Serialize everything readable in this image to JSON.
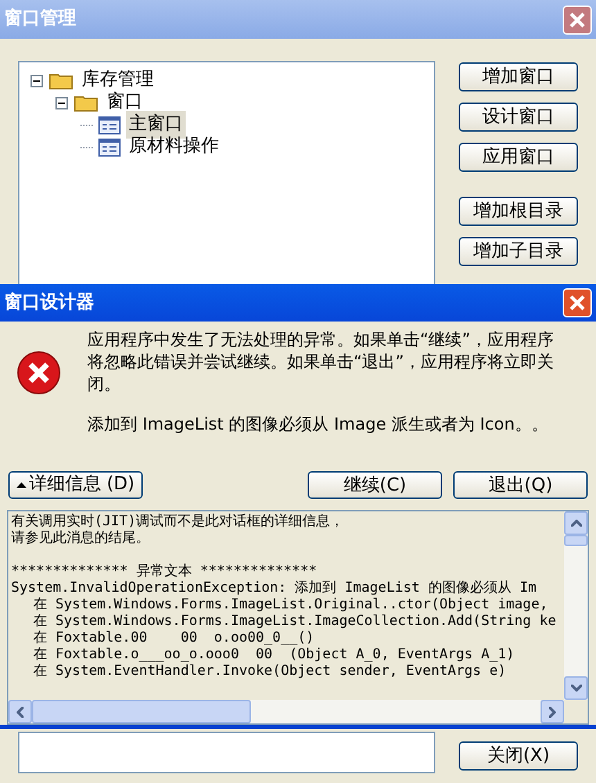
{
  "manager": {
    "title": "窗口管理",
    "tree": [
      {
        "label": "库存管理",
        "kind": "folder",
        "expanded": true,
        "selected": false,
        "children": [
          {
            "label": "窗口",
            "kind": "folder",
            "expanded": true,
            "selected": false,
            "children": [
              {
                "label": "主窗口",
                "kind": "form",
                "selected": true
              },
              {
                "label": "原材料操作",
                "kind": "form",
                "selected": false
              }
            ]
          }
        ]
      }
    ],
    "button_groups": [
      [
        "增加窗口",
        "设计窗口",
        "应用窗口"
      ],
      [
        "增加根目录",
        "增加子目录"
      ]
    ],
    "close_button": "关闭(X)"
  },
  "dialog": {
    "title": "窗口设计器",
    "message": "应用程序中发生了无法处理的异常。如果单击“继续”，应用程序将忽略此错误并尝试继续。如果单击“退出”，应用程序将立即关闭。",
    "detail_message": "添加到 ImageList 的图像必须从 Image 派生或者为 Icon。。",
    "details_button": "详细信息 (D)",
    "buttons": [
      "继续(C)",
      "退出(Q)"
    ],
    "details": [
      {
        "text": "有关调用实时(JIT)调试而不是此对话框的详细信息，",
        "kind": "message"
      },
      {
        "text": "请参见此消息的结尾。",
        "kind": "message"
      },
      {
        "text": "************** 异常文本 **************",
        "kind": "banner"
      },
      {
        "text": "System.InvalidOperationException: 添加到 ImageList 的图像必须从 Im",
        "kind": "message"
      },
      {
        "text": "在 System.Windows.Forms.ImageList.Original..ctor(Object image,",
        "kind": "frame"
      },
      {
        "text": "在 System.Windows.Forms.ImageList.ImageCollection.Add(String ke",
        "kind": "frame"
      },
      {
        "text": "在 Foxtable.00    00  o.oo00_0__()",
        "kind": "frame"
      },
      {
        "text": "在 Foxtable.o___oo_o.ooo0  00  (Object A_0, EventArgs A_1)",
        "kind": "frame"
      },
      {
        "text": "在 System.EventHandler.Invoke(Object sender, EventArgs e)",
        "kind": "frame"
      }
    ]
  }
}
